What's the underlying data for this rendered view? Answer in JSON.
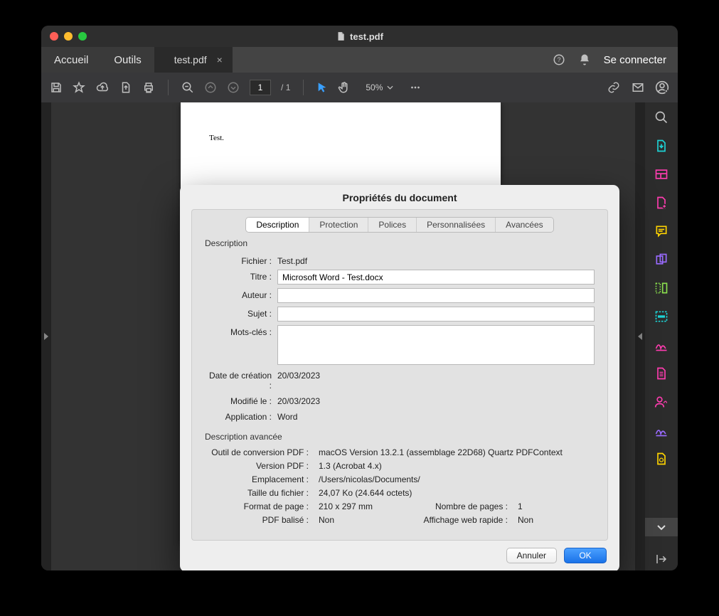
{
  "window": {
    "title": "test.pdf"
  },
  "tabs": {
    "home": "Accueil",
    "tools": "Outils",
    "file": "test.pdf"
  },
  "header": {
    "signin": "Se connecter"
  },
  "toolbar": {
    "page_current": "1",
    "page_sep": "/",
    "page_total": "1",
    "zoom": "50%"
  },
  "document": {
    "page_text": "Test."
  },
  "dialog": {
    "title": "Propriétés du document",
    "tabs": {
      "description": "Description",
      "protection": "Protection",
      "fonts": "Polices",
      "custom": "Personnalisées",
      "advanced": "Avancées"
    },
    "section_description": "Description",
    "fields": {
      "file_label": "Fichier :",
      "file_value": "Test.pdf",
      "title_label": "Titre :",
      "title_value": "Microsoft Word - Test.docx",
      "author_label": "Auteur :",
      "author_value": "",
      "subject_label": "Sujet :",
      "subject_value": "",
      "keywords_label": "Mots-clés :",
      "keywords_value": "",
      "created_label": "Date de création :",
      "created_value": "20/03/2023",
      "modified_label": "Modifié le :",
      "modified_value": "20/03/2023",
      "app_label": "Application :",
      "app_value": "Word"
    },
    "section_advanced": "Description avancée",
    "adv": {
      "tool_label": "Outil de conversion PDF :",
      "tool_value": "macOS Version 13.2.1 (assemblage 22D68) Quartz PDFContext",
      "version_label": "Version PDF :",
      "version_value": "1.3 (Acrobat 4.x)",
      "location_label": "Emplacement :",
      "location_value": "/Users/nicolas/Documents/",
      "size_label": "Taille du fichier :",
      "size_value": "24,07 Ko (24.644 octets)",
      "pagesize_label": "Format de page :",
      "pagesize_value": "210 x 297 mm",
      "pagecount_label": "Nombre de pages :",
      "pagecount_value": "1",
      "tagged_label": "PDF balisé :",
      "tagged_value": "Non",
      "fastweb_label": "Affichage web rapide :",
      "fastweb_value": "Non"
    },
    "buttons": {
      "cancel": "Annuler",
      "ok": "OK"
    }
  },
  "colors": {
    "accent_blue": "#1a72e8",
    "side_cyan": "#1dd3d5",
    "side_magenta": "#ff3db0",
    "side_yellow": "#ffd400",
    "side_purple": "#9a6bff",
    "side_green": "#8be04e"
  }
}
